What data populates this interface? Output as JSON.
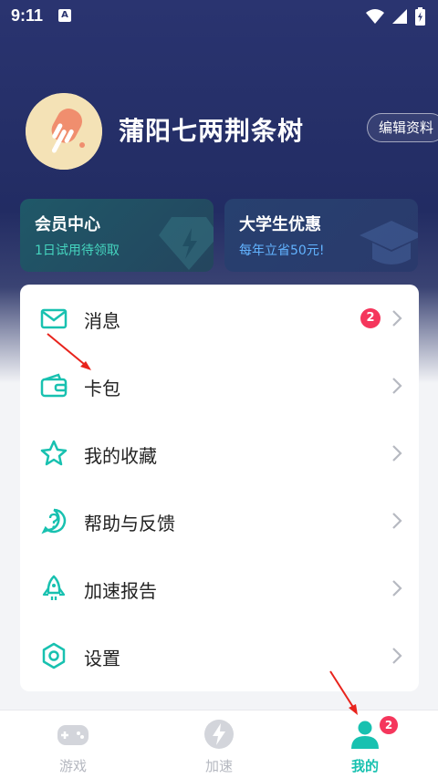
{
  "status_bar": {
    "time": "9:11",
    "notification_letter": "A"
  },
  "profile": {
    "username": "蒲阳七两荆条树",
    "edit_label": "编辑资料"
  },
  "promos": [
    {
      "title": "会员中心",
      "subtitle": "1日试用待领取"
    },
    {
      "title": "大学生优惠",
      "subtitle": "每年立省50元!"
    }
  ],
  "menu": {
    "items": [
      {
        "label": "消息",
        "icon": "mail-icon",
        "badge": "2"
      },
      {
        "label": "卡包",
        "icon": "wallet-icon"
      },
      {
        "label": "我的收藏",
        "icon": "star-icon"
      },
      {
        "label": "帮助与反馈",
        "icon": "help-icon"
      },
      {
        "label": "加速报告",
        "icon": "rocket-icon"
      },
      {
        "label": "设置",
        "icon": "settings-icon"
      }
    ]
  },
  "tabs": {
    "items": [
      {
        "label": "游戏",
        "icon": "gamepad-icon"
      },
      {
        "label": "加速",
        "icon": "bolt-icon"
      },
      {
        "label": "我的",
        "icon": "user-icon",
        "badge": "2",
        "active": true
      }
    ]
  },
  "colors": {
    "accent": "#18c1b0",
    "badge": "#f5365c",
    "header_bg": "#2a3470"
  }
}
